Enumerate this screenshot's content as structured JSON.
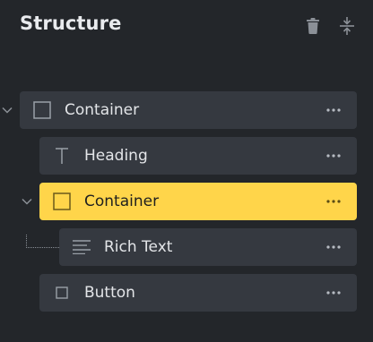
{
  "panel": {
    "title": "Structure"
  },
  "header_icons": [
    {
      "name": "trash-icon"
    },
    {
      "name": "collapse-all-icon"
    }
  ],
  "tree": [
    {
      "label": "Container",
      "icon": "container-square-icon",
      "expanded": true,
      "selected": false
    },
    {
      "label": "Heading",
      "icon": "text-t-icon",
      "selected": false
    },
    {
      "label": "Container",
      "icon": "container-square-icon",
      "expanded": true,
      "selected": true
    },
    {
      "label": "Rich Text",
      "icon": "rich-text-lines-icon",
      "selected": false
    },
    {
      "label": "Button",
      "icon": "button-square-icon",
      "selected": false
    }
  ],
  "colors": {
    "background": "#23262a",
    "row": "#353940",
    "selected": "#ffd54a",
    "text": "#e3e5e8",
    "muted": "#8a8f96"
  }
}
